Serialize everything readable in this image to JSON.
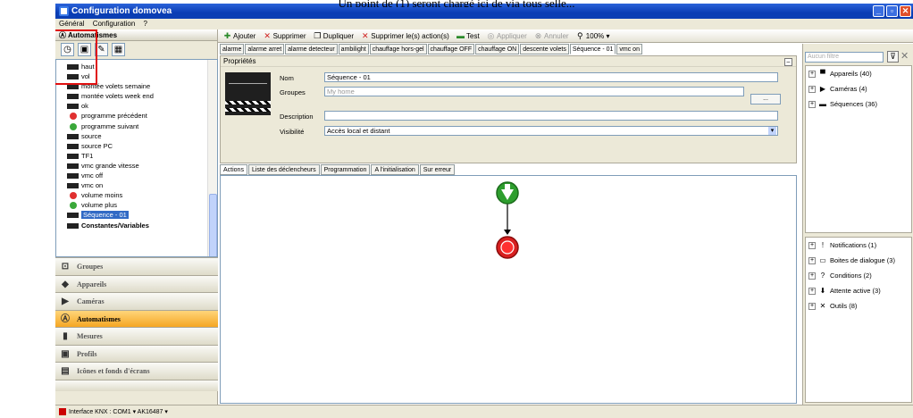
{
  "caption": "Un point de (1) seront chargé ici de via tous selle...",
  "window": {
    "title": "Configuration domovea"
  },
  "menu": [
    "Général",
    "Configuration",
    "?"
  ],
  "callout": {
    "number": "1"
  },
  "left_panel": {
    "header": "Automatismes",
    "tree": [
      {
        "label": "haut",
        "icon": "bar"
      },
      {
        "label": "vol",
        "icon": "bar"
      },
      {
        "label": "montée volets semaine",
        "icon": "bar"
      },
      {
        "label": "montée volets week end",
        "icon": "bar"
      },
      {
        "label": "ok",
        "icon": "bar"
      },
      {
        "label": "programme précédent",
        "icon": "red"
      },
      {
        "label": "programme suivant",
        "icon": "green"
      },
      {
        "label": "source",
        "icon": "bar"
      },
      {
        "label": "source PC",
        "icon": "bar"
      },
      {
        "label": "TF1",
        "icon": "bar"
      },
      {
        "label": "vmc grande vitesse",
        "icon": "bar"
      },
      {
        "label": "vmc off",
        "icon": "bar"
      },
      {
        "label": "vmc on",
        "icon": "bar"
      },
      {
        "label": "volume moins",
        "icon": "red"
      },
      {
        "label": "volume plus",
        "icon": "green"
      },
      {
        "label": "Séquence - 01",
        "icon": "bar",
        "selected": true
      },
      {
        "label": "Constantes/Variables",
        "icon": "bar",
        "bold": true
      }
    ],
    "nav": [
      {
        "label": "Groupes",
        "icon": "⊡"
      },
      {
        "label": "Appareils",
        "icon": "◆"
      },
      {
        "label": "Caméras",
        "icon": "▶"
      },
      {
        "label": "Automatismes",
        "icon": "Ⓐ",
        "active": true
      },
      {
        "label": "Mesures",
        "icon": "▮"
      },
      {
        "label": "Profils",
        "icon": "▣"
      },
      {
        "label": "Icônes et fonds d'écrans",
        "icon": "▤"
      }
    ]
  },
  "toolbar": {
    "add": "Ajouter",
    "delete": "Supprimer",
    "duplicate": "Dupliquer",
    "delete_actions": "Supprimer le(s) action(s)",
    "test": "Test",
    "apply": "Appliquer",
    "cancel": "Annuler",
    "zoom": "100%"
  },
  "sequence_tabs": [
    "alarme",
    "alarme arret",
    "alarme detecteur",
    "ambilight",
    "chauffage hors-gel",
    "chauffage OFF",
    "chauffage ON",
    "descente volets",
    "Séquence - 01",
    "vmc on"
  ],
  "active_tab_index": 8,
  "properties": {
    "title": "Propriétés",
    "name_label": "Nom",
    "name_value": "Séquence - 01",
    "groups_label": "Groupes",
    "groups_value": "My home",
    "groups_button": "...",
    "description_label": "Description",
    "description_value": "",
    "visibility_label": "Visibilité",
    "visibility_value": "Accès local et distant"
  },
  "sub_tabs": [
    "Actions",
    "Liste des déclencheurs",
    "Programmation",
    "A l'initialisation",
    "Sur erreur"
  ],
  "right_panel": {
    "filter_placeholder": "Aucun filtre",
    "top_items": [
      {
        "label": "Appareils (40)",
        "icon": "▀"
      },
      {
        "label": "Caméras (4)",
        "icon": "▶"
      },
      {
        "label": "Séquences (36)",
        "icon": "▬"
      }
    ],
    "bottom_items": [
      {
        "label": "Notifications (1)",
        "icon": "!"
      },
      {
        "label": "Boites de dialogue (3)",
        "icon": "▭"
      },
      {
        "label": "Conditions (2)",
        "icon": "?"
      },
      {
        "label": "Attente active (3)",
        "icon": "⬇"
      },
      {
        "label": "Outils (8)",
        "icon": "✕"
      }
    ]
  },
  "status": {
    "text": "Interface KNX : COM1 ▾  AK16487 ▾"
  }
}
